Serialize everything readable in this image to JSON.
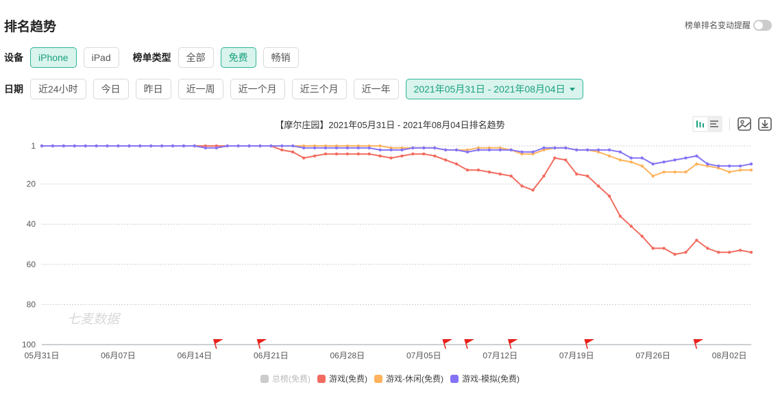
{
  "header": {
    "title": "排名趋势",
    "alert_label": "榜单排名变动提醒",
    "alert_enabled": false
  },
  "filters": {
    "device_label": "设备",
    "devices": [
      {
        "label": "iPhone",
        "active": true
      },
      {
        "label": "iPad",
        "active": false
      }
    ],
    "type_label": "榜单类型",
    "types": [
      {
        "label": "全部",
        "active": false
      },
      {
        "label": "免费",
        "active": true
      },
      {
        "label": "畅销",
        "active": false
      }
    ],
    "date_label": "日期",
    "dates": [
      {
        "label": "近24小时"
      },
      {
        "label": "今日"
      },
      {
        "label": "昨日"
      },
      {
        "label": "近一周"
      },
      {
        "label": "近一个月"
      },
      {
        "label": "近三个月"
      },
      {
        "label": "近一年"
      }
    ],
    "date_range": "2021年05月31日 - 2021年08月04日"
  },
  "toolbar": {
    "icons": [
      "bar-view-icon",
      "list-view-icon",
      "save-image-icon",
      "download-icon"
    ]
  },
  "watermark": "七麦数据",
  "colors": {
    "red": "#f26b5f",
    "orange": "#ffb35c",
    "purple": "#8474f5",
    "gray": "#cccccc"
  },
  "chart_data": {
    "type": "line",
    "title": "【摩尔庄园】2021年05月31日 - 2021年08月04日排名趋势",
    "y_inverted": true,
    "ylim": [
      1,
      100
    ],
    "yticks": [
      1,
      20,
      40,
      60,
      80,
      100
    ],
    "xticks": [
      "05月31日",
      "06月07日",
      "06月14日",
      "06月21日",
      "06月28日",
      "07月05日",
      "07月12日",
      "07月19日",
      "07月26日",
      "08月02日"
    ],
    "x_start": "2021-05-31",
    "x_count": 66,
    "grid": true,
    "legend_position": "bottom",
    "series": [
      {
        "name": "总榜(免费)",
        "color": "#cccccc",
        "visible": false,
        "values": []
      },
      {
        "name": "游戏(免费)",
        "color": "#f26b5f",
        "visible": true,
        "values": [
          1,
          1,
          1,
          1,
          1,
          1,
          1,
          1,
          1,
          1,
          1,
          1,
          1,
          1,
          1,
          1,
          1,
          1,
          1,
          1,
          1,
          1,
          3,
          4,
          7,
          6,
          5,
          5,
          5,
          5,
          5,
          6,
          7,
          6,
          5,
          5,
          6,
          8,
          10,
          13,
          13,
          14,
          15,
          16,
          21,
          23,
          16,
          7,
          8,
          15,
          16,
          21,
          26,
          36,
          41,
          46,
          52,
          52,
          55,
          54,
          48,
          52,
          54,
          54,
          53,
          54
        ]
      },
      {
        "name": "游戏-休闲(免费)",
        "color": "#ffb35c",
        "visible": true,
        "values": [
          1,
          1,
          1,
          1,
          1,
          1,
          1,
          1,
          1,
          1,
          1,
          1,
          1,
          1,
          1,
          2,
          2,
          1,
          1,
          1,
          1,
          1,
          1,
          1,
          1,
          1,
          1,
          1,
          1,
          1,
          1,
          1,
          2,
          2,
          2,
          2,
          2,
          3,
          3,
          3,
          2,
          2,
          2,
          3,
          5,
          5,
          3,
          2,
          2,
          3,
          3,
          4,
          6,
          8,
          9,
          11,
          16,
          14,
          14,
          14,
          10,
          11,
          12,
          14,
          13,
          13
        ]
      },
      {
        "name": "游戏-模拟(免费)",
        "color": "#8474f5",
        "visible": true,
        "values": [
          1,
          1,
          1,
          1,
          1,
          1,
          1,
          1,
          1,
          1,
          1,
          1,
          1,
          1,
          1,
          2,
          2,
          1,
          1,
          1,
          1,
          1,
          1,
          1,
          2,
          2,
          2,
          2,
          2,
          2,
          2,
          3,
          3,
          3,
          2,
          2,
          2,
          3,
          3,
          4,
          3,
          3,
          3,
          3,
          4,
          4,
          2,
          2,
          2,
          3,
          3,
          3,
          3,
          4,
          7,
          7,
          10,
          9,
          8,
          7,
          6,
          10,
          11,
          11,
          11,
          10
        ]
      }
    ],
    "event_flags_day_index": [
      16,
      20,
      37,
      39,
      43,
      50,
      60
    ]
  }
}
